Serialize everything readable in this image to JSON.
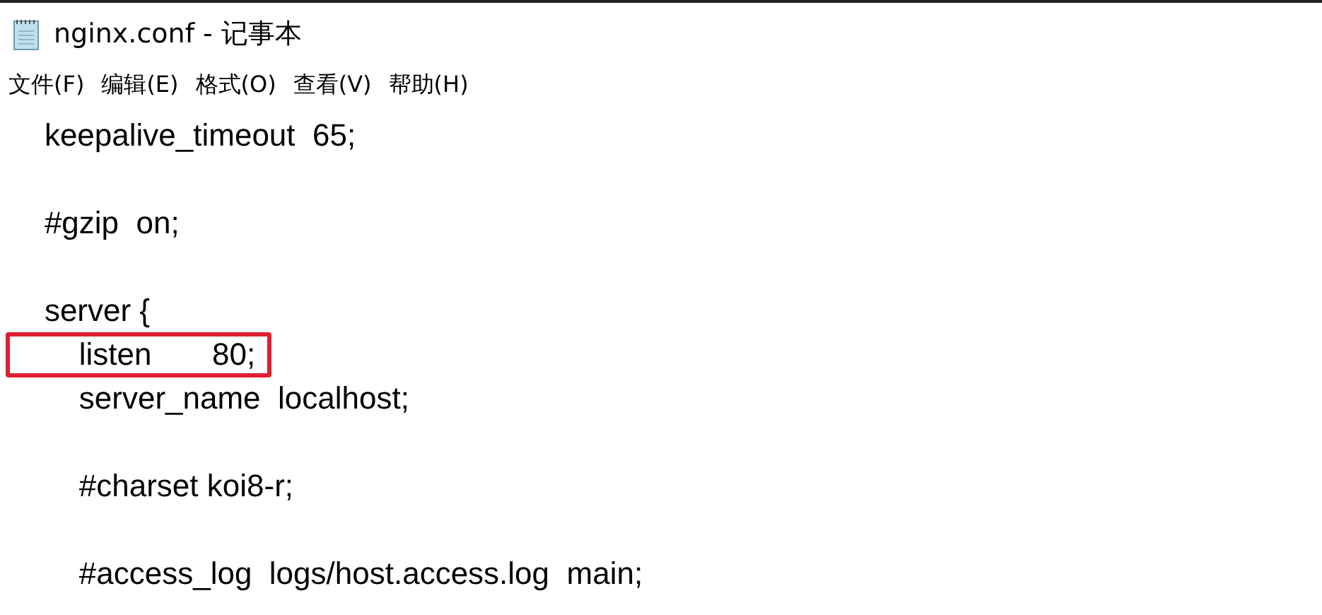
{
  "window": {
    "title": "nginx.conf - 记事本"
  },
  "menu": [
    "文件(F)",
    "编辑(E)",
    "格式(O)",
    "查看(V)",
    "帮助(H)"
  ],
  "lines": [
    {
      "kind": "code",
      "text": "    keepalive_timeout  65;",
      "highlighted": false
    },
    {
      "kind": "blank"
    },
    {
      "kind": "code",
      "text": "    #gzip  on;",
      "highlighted": false
    },
    {
      "kind": "blank"
    },
    {
      "kind": "code",
      "text": "    server {",
      "highlighted": false
    },
    {
      "kind": "code",
      "text": "        listen       80;",
      "highlighted": true
    },
    {
      "kind": "code",
      "text": "        server_name  localhost;",
      "highlighted": false
    },
    {
      "kind": "blank"
    },
    {
      "kind": "code",
      "text": "        #charset koi8-r;",
      "highlighted": false
    },
    {
      "kind": "blank"
    },
    {
      "kind": "code",
      "text": "        #access_log  logs/host.access.log  main;",
      "highlighted": false
    }
  ]
}
